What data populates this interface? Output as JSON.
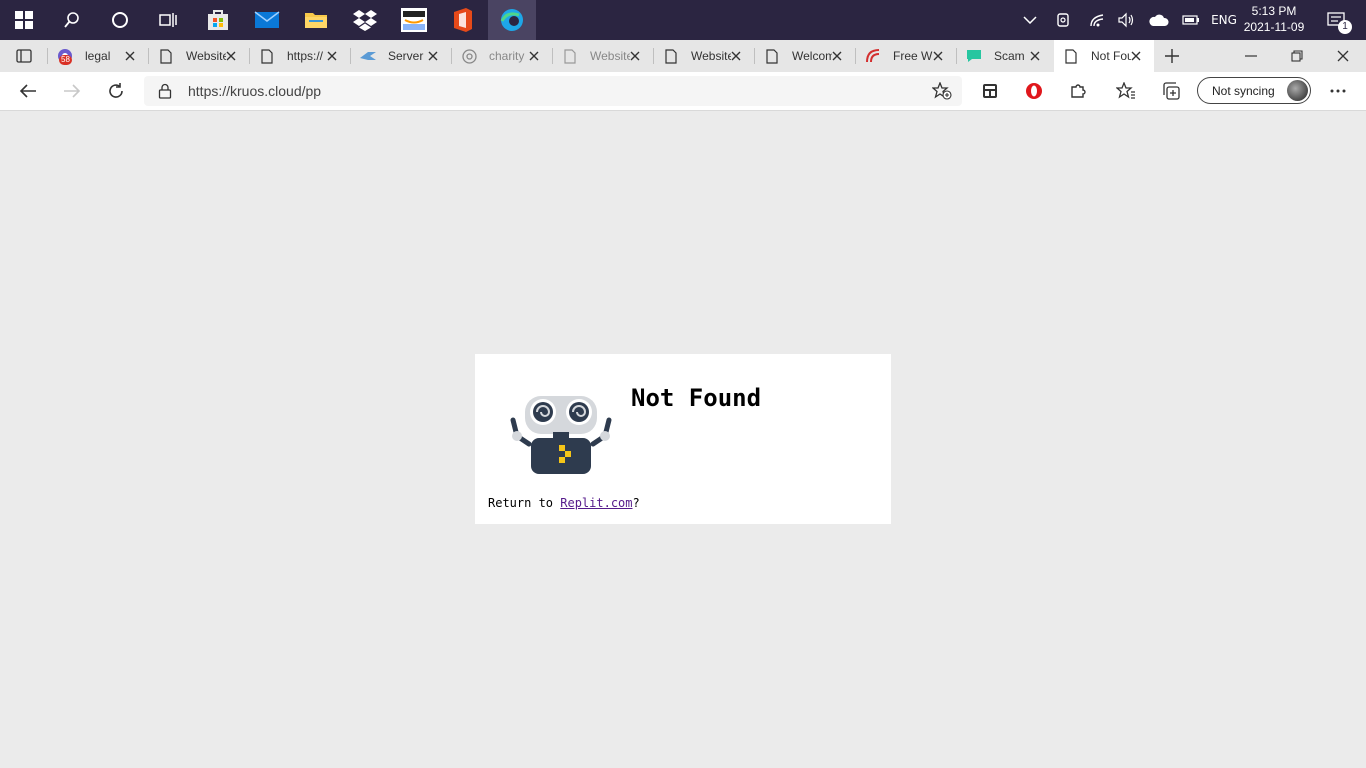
{
  "taskbar": {
    "tray": {
      "language": "ENG",
      "notifications_count": "1"
    },
    "clock": {
      "time": "5:13 PM",
      "date": "2021-11-09"
    }
  },
  "tabs": [
    {
      "label": "legal",
      "badge": "58"
    },
    {
      "label": "Website"
    },
    {
      "label": "https://"
    },
    {
      "label": "Server"
    },
    {
      "label": "charity"
    },
    {
      "label": "Website"
    },
    {
      "label": "Website"
    },
    {
      "label": "Welcome"
    },
    {
      "label": "Free W"
    },
    {
      "label": "Scam"
    },
    {
      "label": "Not Found",
      "active": true
    }
  ],
  "address_bar": {
    "url": "https://kruos.cloud/pp"
  },
  "profile": {
    "label": "Not syncing"
  },
  "page": {
    "title": "Not Found",
    "return_prefix": "Return to ",
    "return_link": "Replit.com",
    "return_suffix": "?"
  }
}
